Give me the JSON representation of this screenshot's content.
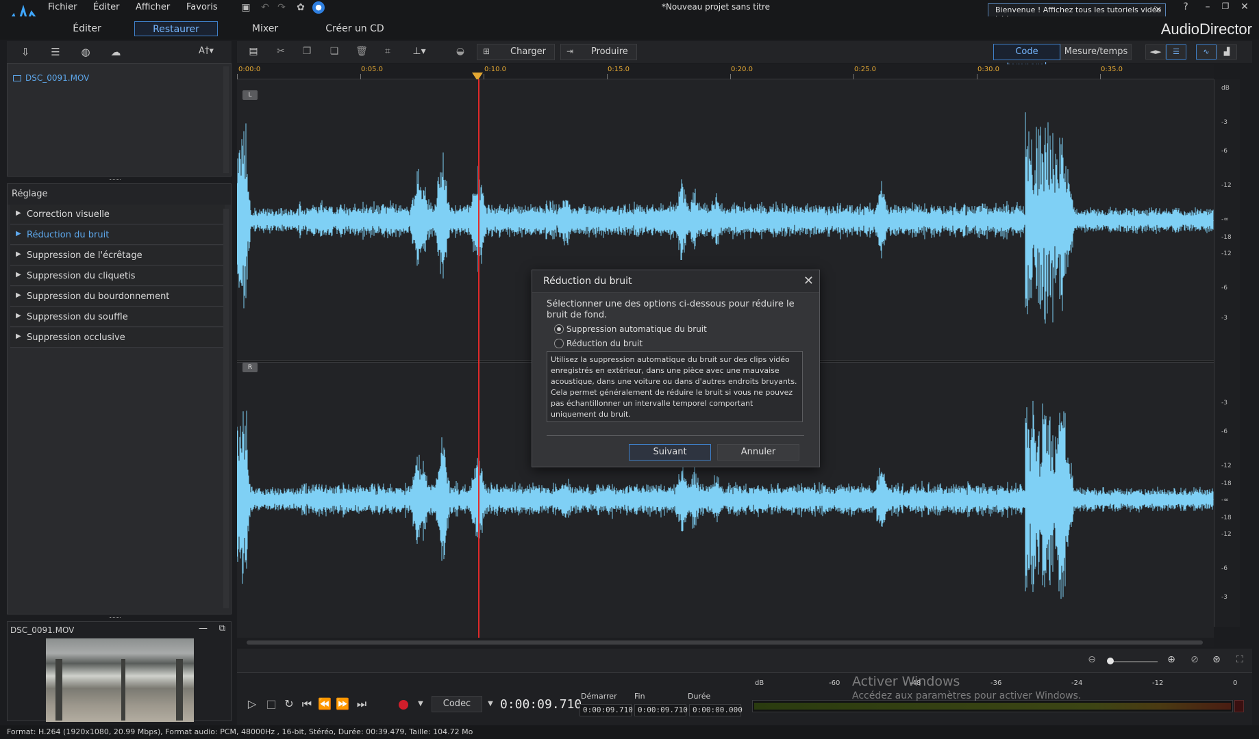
{
  "menu": {
    "items": [
      "Fichier",
      "Éditer",
      "Afficher",
      "Favoris"
    ],
    "doc_title": "*Nouveau projet sans titre",
    "welcome": "Bienvenue ! Affichez tous les tutoriels vidéo ici !",
    "help": "?"
  },
  "modes": {
    "tabs": [
      "Éditer",
      "Restaurer",
      "Mixer",
      "Créer un CD"
    ],
    "active": "Restaurer",
    "brand": "AudioDirector"
  },
  "left_toolbar": {
    "font_button": "A†▾"
  },
  "media": {
    "file": "DSC_0091.MOV"
  },
  "fix": {
    "title": "Réglage",
    "items": [
      "Correction visuelle",
      "Réduction du bruit",
      "Suppression de l'écrêtage",
      "Suppression du cliquetis",
      "Suppression du bourdonnement",
      "Suppression du souffle",
      "Suppression occlusive"
    ],
    "selected": "Réduction du bruit"
  },
  "preview": {
    "title": "DSC_0091.MOV"
  },
  "edit_toolbar": {
    "charger": "Charger",
    "produire": "Produire",
    "code_temporel": "Code temporel",
    "mesure_temps": "Mesure/temps"
  },
  "ruler": {
    "labels": [
      "0:00:0",
      "0:05.0",
      "0:10.0",
      "0:15.0",
      "0:20.0",
      "0:25.0",
      "0:30.0",
      "0:35.0"
    ]
  },
  "tracks": {
    "left": "L",
    "right": "R"
  },
  "db_scale": {
    "unit": "dB",
    "left_ticks": [
      "-3",
      "-6",
      "-12",
      "-∞",
      "-18",
      "-12",
      "-6",
      "-3"
    ],
    "right_ticks": [
      "-3",
      "-6",
      "-12",
      "-18",
      "-∞",
      "-18",
      "-12",
      "-6",
      "-3"
    ]
  },
  "transport": {
    "codec": "Codec",
    "time": "0:00:09.710",
    "start_label": "Démarrer",
    "end_label": "Fin",
    "duration_label": "Durée",
    "start": "0:00:09.710",
    "end": "0:00:09.710",
    "duration": "0:00:00.000",
    "meter_ticks": [
      "dB",
      "-60",
      "-48",
      "-36",
      "-24",
      "-12",
      "0"
    ]
  },
  "activation": {
    "line1": "Activer Windows",
    "line2": "Accédez aux paramètres pour activer Windows."
  },
  "status": "Format: H.264 (1920x1080, 20.99 Mbps), Format audio: PCM, 48000Hz , 16-bit, Stéréo, Durée: 00:39.479, Taille: 104.72 Mo",
  "dialog": {
    "title": "Réduction du bruit",
    "instruction": "Sélectionner une des options ci-dessous pour réduire le bruit de fond.",
    "option1": "Suppression automatique du bruit",
    "option2": "Réduction du bruit",
    "selected_option": "Suppression automatique du bruit",
    "description": "Utilisez la suppression automatique du bruit sur des clips vidéo enregistrés en extérieur, dans une pièce avec une mauvaise acoustique, dans une voiture ou dans d'autres endroits bruyants. Cela permet généralement de réduire le bruit si vous ne pouvez pas échantillonner un intervalle temporel comportant uniquement du bruit.",
    "next": "Suivant",
    "cancel": "Annuler"
  },
  "colors": {
    "waveform": "#7fd0f5",
    "accent": "#5ea8ec",
    "playhead": "#e02a2a",
    "ruler_labels": "#e4a833"
  }
}
